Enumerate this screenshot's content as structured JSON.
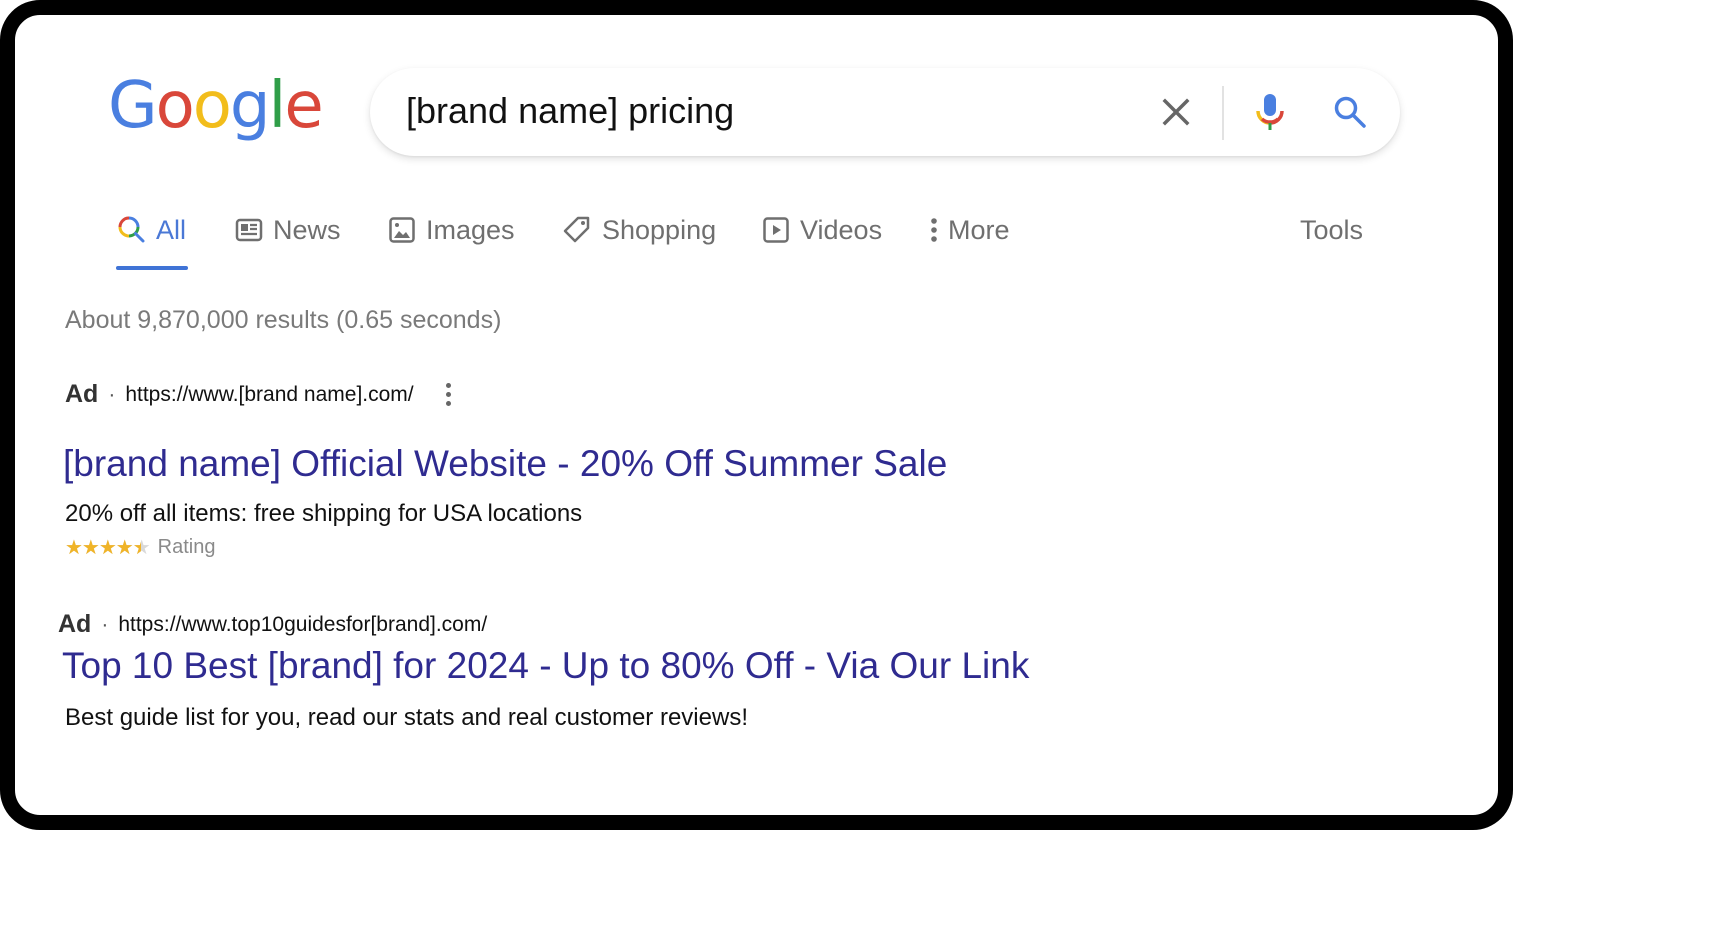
{
  "logo": {
    "text": "Google",
    "letters": [
      {
        "ch": "G",
        "color": "#4a7fe0"
      },
      {
        "ch": "o",
        "color": "#d9473a"
      },
      {
        "ch": "o",
        "color": "#f2bd1b"
      },
      {
        "ch": "g",
        "color": "#4a7fe0"
      },
      {
        "ch": "l",
        "color": "#2f9e48"
      },
      {
        "ch": "e",
        "color": "#d9473a"
      }
    ]
  },
  "search": {
    "query": "[brand name] pricing",
    "icons": {
      "clear": "close-icon",
      "voice": "microphone-icon",
      "submit": "search-icon"
    }
  },
  "tabs": [
    {
      "label": "All",
      "icon": "search-icon",
      "active": true
    },
    {
      "label": "News",
      "icon": "newspaper-icon",
      "active": false
    },
    {
      "label": "Images",
      "icon": "image-icon",
      "active": false
    },
    {
      "label": "Shopping",
      "icon": "tag-icon",
      "active": false
    },
    {
      "label": "Videos",
      "icon": "play-icon",
      "active": false
    },
    {
      "label": "More",
      "icon": "more-vertical-icon",
      "active": false
    }
  ],
  "tools_label": "Tools",
  "results_count": "About 9,870,000 results (0.65 seconds)",
  "ads": [
    {
      "badge": "Ad",
      "separator": "·",
      "url": "https://www.[brand name].com/",
      "title": "[brand name] Official Website - 20% Off Summer Sale",
      "description": "20% off all items: free shipping for USA locations",
      "rating": {
        "stars": 4.5,
        "max": 5,
        "label": "Rating"
      }
    },
    {
      "badge": "Ad",
      "separator": "·",
      "url": "https://www.top10guidesfor[brand].com/",
      "title": "Top 10 Best [brand] for 2024 - Up to 80% Off - Via Our Link",
      "description": "Best guide list for you, read our stats and real customer reviews!"
    }
  ],
  "colors": {
    "ad_title": "#2f2b90",
    "active_tab": "#4a78d6",
    "star": "#f0b428"
  }
}
